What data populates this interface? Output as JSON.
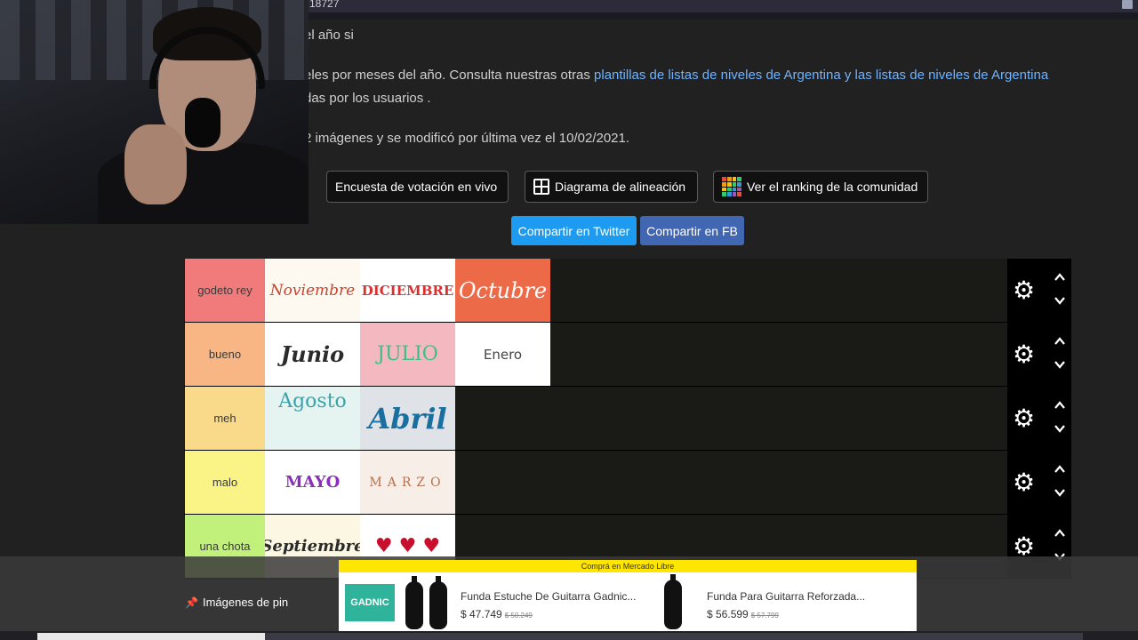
{
  "header": {
    "title_fragment": "18727"
  },
  "description": {
    "line1": "el año si",
    "line2_prefix": "eles por meses del año. Consulta nuestras otras ",
    "line2_link1": "plantillas de listas de niveles de Argentina",
    "line2_link2": " y las listas de niveles de Argentina",
    "line3": "das por los usuarios .",
    "line4": "2 imágenes y se modificó por última vez el 10/02/2021."
  },
  "actions": {
    "poll_label": "Encuesta de votación en vivo",
    "alignment_label": "Diagrama de alineación",
    "ranking_label": "Ver el ranking de la comunidad"
  },
  "share": {
    "twitter_label": "Compartir en Twitter",
    "facebook_label": "Compartir en FB"
  },
  "tiers": [
    {
      "label": "godeto rey",
      "color": "#f17b7b",
      "items": [
        "Noviembre",
        "DICIEMBRE",
        "Octubre"
      ]
    },
    {
      "label": "bueno",
      "color": "#f7b683",
      "items": [
        "Junio",
        "JULIO",
        "Enero"
      ]
    },
    {
      "label": "meh",
      "color": "#f9d98a",
      "items": [
        "Agosto",
        "Abril"
      ]
    },
    {
      "label": "malo",
      "color": "#f9f485",
      "items": [
        "MAYO",
        "MARZO"
      ]
    },
    {
      "label": "una chota",
      "color": "#c2f17b",
      "items": [
        "Septiembre",
        "♥ ♥ ♥"
      ]
    }
  ],
  "pin_images_label": "Imágenes de pin",
  "ad": {
    "header": "Comprá en Mercado Libre",
    "brand": "GADNIC",
    "products": [
      {
        "title": "Funda Estuche De Guitarra Gadnic...",
        "price": "$ 47.749",
        "old_price": "$ 50.249"
      },
      {
        "title": "Funda Para Guitarra Reforzada...",
        "price": "$ 56.599",
        "old_price": "$ 57.799"
      }
    ]
  },
  "colors": {
    "link": "#6fb3ff",
    "twitter": "#1d9bf0",
    "facebook": "#4267b2",
    "ml_yellow": "#ffe600"
  },
  "icons": [
    "grid-icon",
    "ranking-icon",
    "gear-icon",
    "chevron-up-icon",
    "chevron-down-icon",
    "pin-icon"
  ]
}
